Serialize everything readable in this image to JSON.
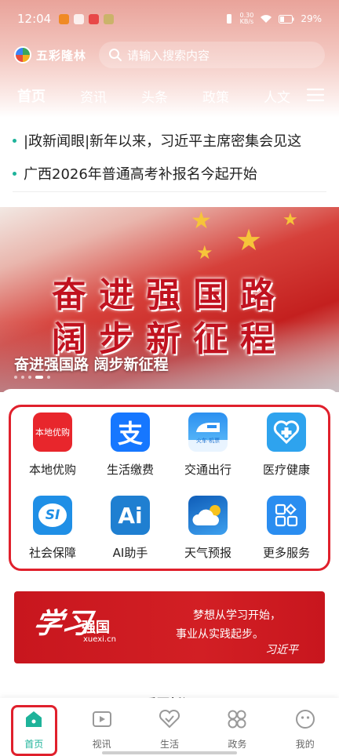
{
  "status_bar": {
    "time": "12:04",
    "net_speed_value": "0.30",
    "net_speed_unit": "KB/s",
    "battery": "29%"
  },
  "header": {
    "app_name": "五彩隆林",
    "search_placeholder": "请输入搜索内容"
  },
  "nav_tabs": [
    "首页",
    "资讯",
    "头条",
    "政策",
    "人文"
  ],
  "ticker": [
    "|政新闻眼|新年以来，习近平主席密集会见这",
    "广西2026年普通高考补报名今起开始"
  ],
  "banner": {
    "line1": "奋进强国路",
    "line2": "阔步新征程",
    "caption": "奋进强国路 阔步新征程"
  },
  "services": [
    {
      "label": "本地优购",
      "icon": "local-shopping-icon",
      "badge": "本地优购",
      "color": "#e8262c"
    },
    {
      "label": "生活缴费",
      "icon": "alipay-icon",
      "badge": "支",
      "color": "#1677ff"
    },
    {
      "label": "交通出行",
      "icon": "train-icon",
      "badge": "火车·机票",
      "color": "#1a8df0"
    },
    {
      "label": "医疗健康",
      "icon": "medical-heart-icon",
      "badge": "",
      "color": "#2ea3ee"
    },
    {
      "label": "社会保障",
      "icon": "social-security-icon",
      "badge": "SI",
      "color": "#1f8fe6"
    },
    {
      "label": "AI助手",
      "icon": "ai-assistant-icon",
      "badge": "Ai",
      "color": "#1f7fd1"
    },
    {
      "label": "天气预报",
      "icon": "weather-icon",
      "badge": "",
      "color": "#1c6fd6"
    },
    {
      "label": "更多服务",
      "icon": "more-services-icon",
      "badge": "",
      "color": "#2a8df0"
    }
  ],
  "promo": {
    "script": "学习",
    "brand": "强国",
    "domain": "xuexi.cn",
    "motto_line1": "梦想从学习开始，",
    "motto_line2": "事业从实践起步。",
    "signature": "习近平"
  },
  "section_title": "重要新闻",
  "tabbar": [
    {
      "label": "首页",
      "icon": "home-icon",
      "active": true
    },
    {
      "label": "视讯",
      "icon": "video-icon",
      "active": false
    },
    {
      "label": "生活",
      "icon": "life-heart-icon",
      "active": false
    },
    {
      "label": "政务",
      "icon": "government-services-icon",
      "active": false
    },
    {
      "label": "我的",
      "icon": "profile-icon",
      "active": false
    }
  ],
  "colors": {
    "accent": "#1eb39a",
    "highlight_frame": "#e0202c",
    "banner_text": "#c1121f"
  }
}
